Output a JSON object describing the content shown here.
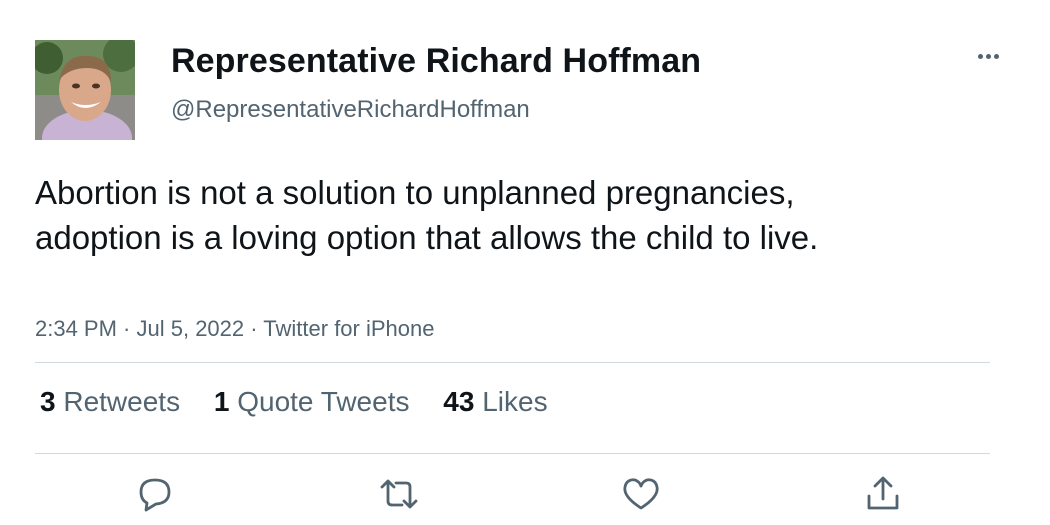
{
  "user": {
    "display_name": "Representative Richard Hoffman",
    "handle": "@RepresentativeRichardHoffman",
    "avatar_icon": "profile-photo"
  },
  "tweet": {
    "text": "Abortion is not a solution to unplanned pregnancies, adoption is a loving option that allows the child to live.",
    "time": "2:34 PM",
    "date": "Jul 5, 2022",
    "source": "Twitter for iPhone",
    "separator": " · "
  },
  "stats": [
    {
      "count": "3",
      "label": "Retweets"
    },
    {
      "count": "1",
      "label": "Quote Tweets"
    },
    {
      "count": "43",
      "label": "Likes"
    }
  ],
  "actions": [
    {
      "icon": "reply-icon"
    },
    {
      "icon": "retweet-icon"
    },
    {
      "icon": "like-icon"
    },
    {
      "icon": "share-icon"
    }
  ],
  "colors": {
    "text_primary": "#0f1419",
    "text_secondary": "#536471",
    "divider": "#cfd9de"
  }
}
